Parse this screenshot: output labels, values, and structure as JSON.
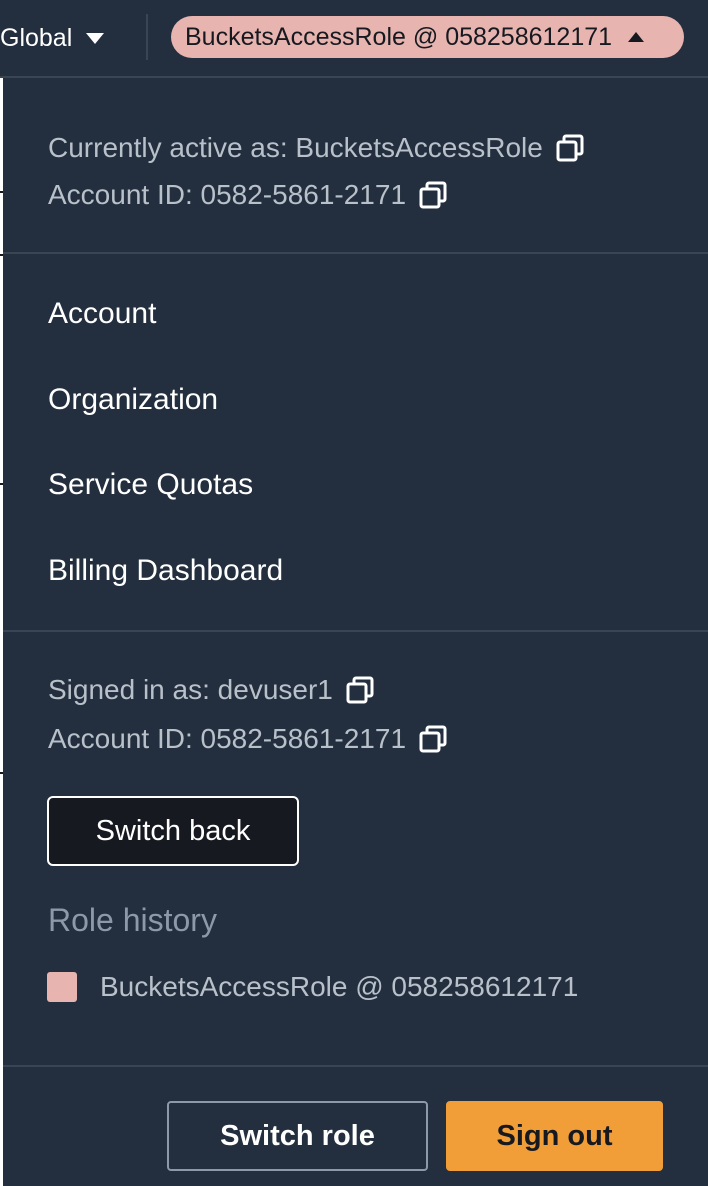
{
  "nav": {
    "region_label": "Global",
    "role_pill_label": "BucketsAccessRole @ 058258612171",
    "role_color": "#e8b4b0"
  },
  "active_session": {
    "currently_active_label": "Currently active as: BucketsAccessRole",
    "account_id_label": "Account ID: 0582-5861-2171"
  },
  "menu": {
    "items": [
      {
        "label": "Account"
      },
      {
        "label": "Organization"
      },
      {
        "label": "Service Quotas"
      },
      {
        "label": "Billing Dashboard"
      }
    ]
  },
  "signed_in": {
    "signed_in_label": "Signed in as: devuser1",
    "account_id_label": "Account ID: 0582-5861-2171",
    "switch_back_label": "Switch back"
  },
  "role_history": {
    "heading": "Role history",
    "items": [
      {
        "label": "BucketsAccessRole @ 058258612171",
        "color": "#e8b4b0"
      }
    ]
  },
  "footer": {
    "switch_role_label": "Switch role",
    "sign_out_label": "Sign out"
  },
  "icons": {
    "copy": "copy-icon",
    "region_caret": "caret-down-icon",
    "pill_caret": "caret-up-icon"
  },
  "colors": {
    "panel_bg": "#232f3e",
    "divider": "#3a4554",
    "accent_orange": "#f19e38",
    "muted_text": "#b8c0ca"
  }
}
